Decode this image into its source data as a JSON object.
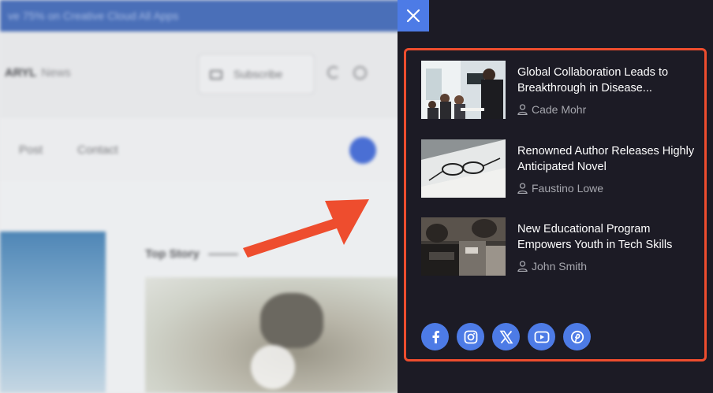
{
  "background": {
    "banner_text": "ve 75% on Creative Cloud All Apps",
    "brand_name": "ARYL",
    "brand_tag": "News",
    "subscribe_label": "Subscribe",
    "nav_items": [
      "Post",
      "Contact"
    ],
    "section_title": "Top Story"
  },
  "panel": {
    "close_icon": "close-icon",
    "accent_color": "#4d7be6",
    "highlight_color": "#ee4d2e",
    "stories": [
      {
        "title": "Global Collaboration Leads to Breakthrough in Disease...",
        "author": "Cade Mohr"
      },
      {
        "title": "Renowned Author Releases Highly Anticipated Novel",
        "author": "Faustino Lowe"
      },
      {
        "title": "New Educational Program Empowers Youth in Tech Skills",
        "author": "John Smith"
      }
    ],
    "social_links": [
      "facebook-icon",
      "instagram-icon",
      "x-icon",
      "youtube-icon",
      "threads-icon"
    ]
  }
}
